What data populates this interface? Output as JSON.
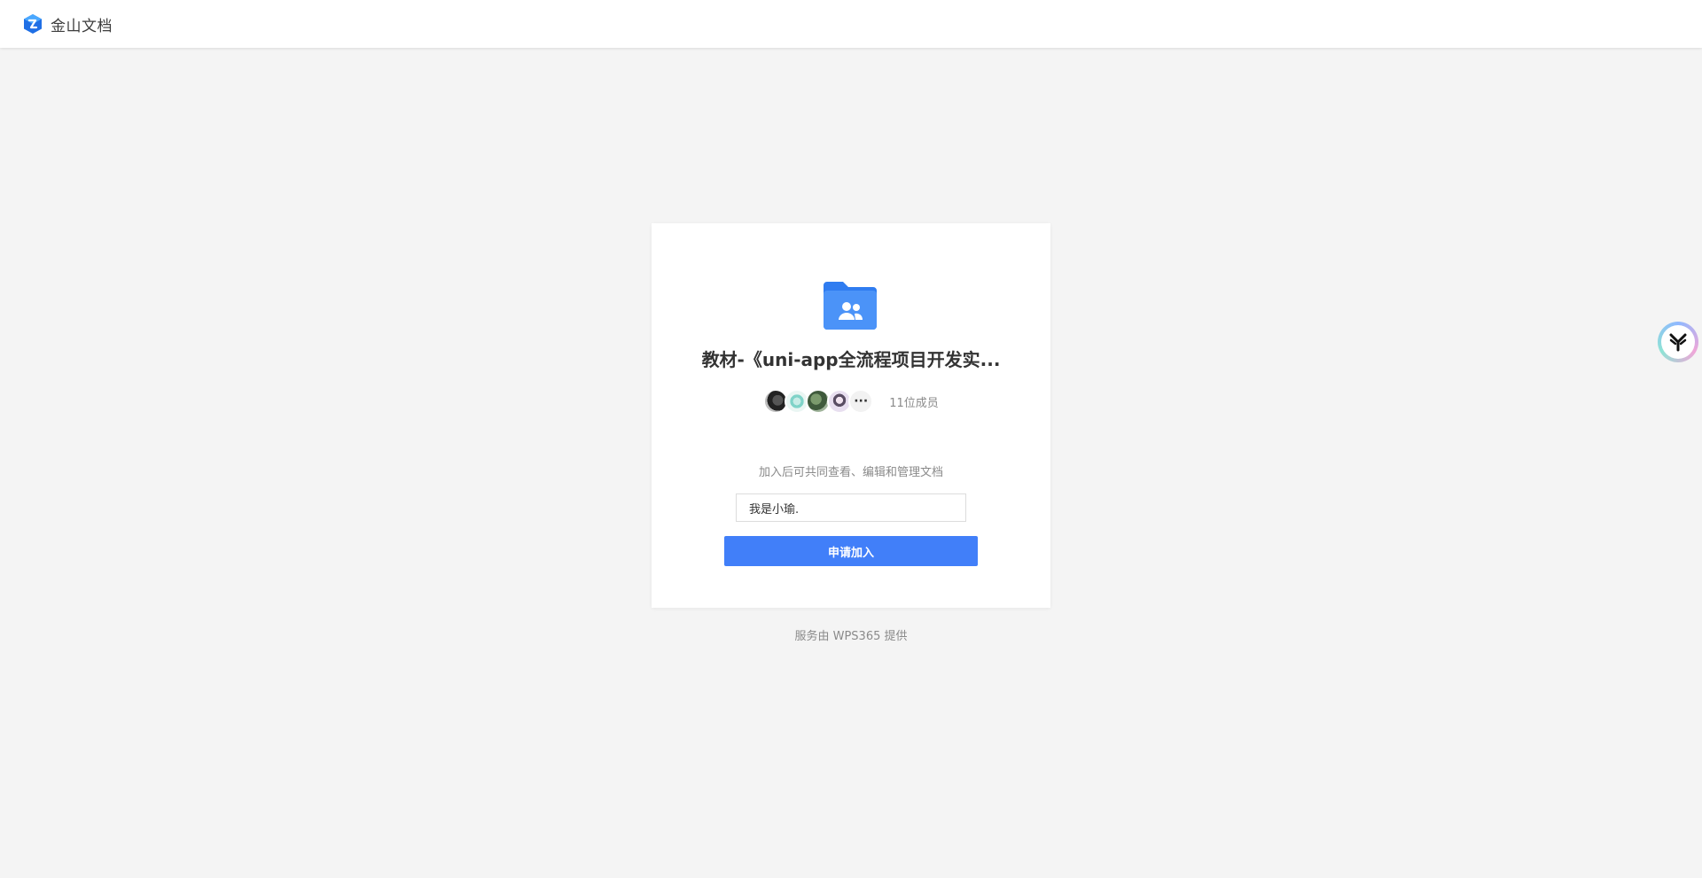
{
  "header": {
    "brand_name": "金山文档",
    "logo_icon": "kingsoft-docs-logo-icon"
  },
  "card": {
    "folder_icon": "shared-folder-icon",
    "folder_title": "教材-《uni-app全流程项目开发实...",
    "members": {
      "avatars": [
        "avatar-1",
        "avatar-2",
        "avatar-3",
        "avatar-4"
      ],
      "more_label": "···",
      "count_label": "11位成员"
    },
    "hint": "加入后可共同查看、编辑和管理文档",
    "message_input": {
      "value": "我是小瑜."
    },
    "apply_button_label": "申请加入"
  },
  "footer": {
    "note": "服务由 WPS365 提供"
  },
  "floating": {
    "assistant_icon": "ai-assistant-icon"
  },
  "colors": {
    "primary": "#417ff9",
    "background": "#f4f4f4",
    "folder_blue": "#3b82f6"
  }
}
